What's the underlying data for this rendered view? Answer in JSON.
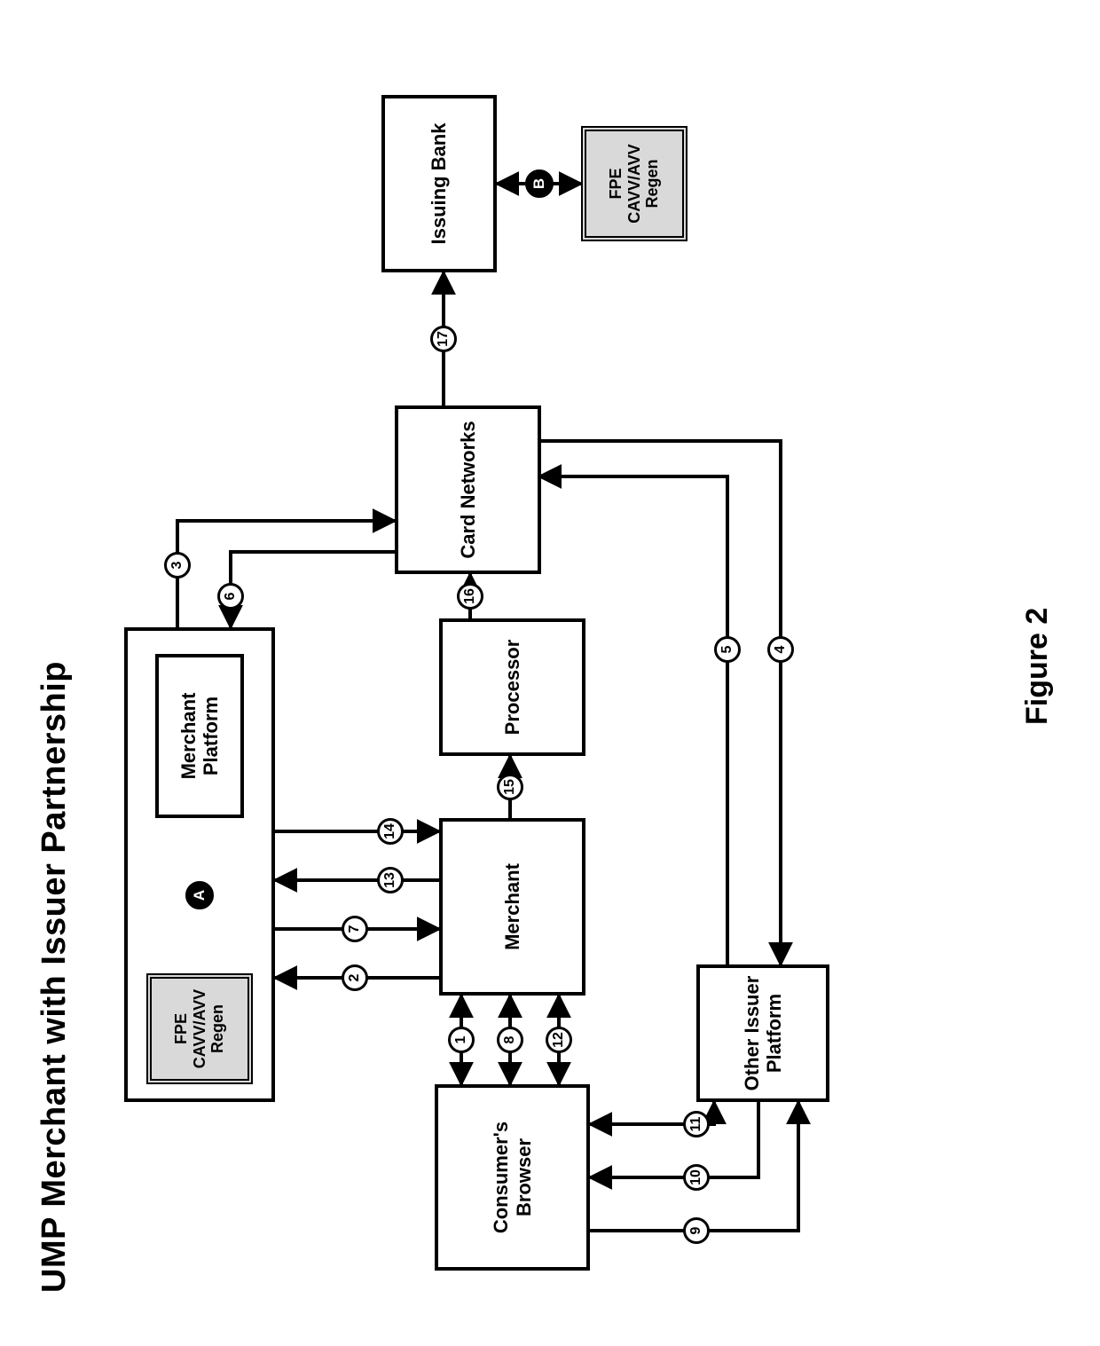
{
  "title": "UMP Merchant with Issuer Partnership",
  "figure_caption": "Figure 2",
  "boxes": {
    "fpe_platform": "FPE\nCAVV/AVV\nRegen",
    "merchant_platform": "Merchant\nPlatform",
    "consumer_browser": "Consumer's\nBrowser",
    "merchant": "Merchant",
    "processor": "Processor",
    "card_networks": "Card\nNetworks",
    "issuing_bank": "Issuing\nBank",
    "fpe_bank": "FPE\nCAVV/AVV\nRegen",
    "other_issuer_platform": "Other\nIssuer\nPlatform"
  },
  "letters": {
    "a": "A",
    "b": "B"
  },
  "steps": {
    "s1": "1",
    "s2": "2",
    "s3": "3",
    "s4": "4",
    "s5": "5",
    "s6": "6",
    "s7": "7",
    "s8": "8",
    "s9": "9",
    "s10": "10",
    "s11": "11",
    "s12": "12",
    "s13": "13",
    "s14": "14",
    "s15": "15",
    "s16": "16",
    "s17": "17"
  }
}
